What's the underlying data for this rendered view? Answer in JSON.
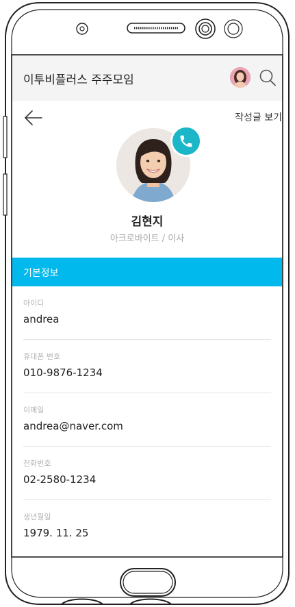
{
  "app": {
    "title": "이투비플러스 주주모임"
  },
  "header": {
    "posts_link": "작성글 보기"
  },
  "profile": {
    "name": "김현지",
    "subtitle": "아크로바이트 / 이사"
  },
  "section": {
    "title": "기본정보"
  },
  "fields": [
    {
      "label": "아이디",
      "value": "andrea"
    },
    {
      "label": "휴대폰 번호",
      "value": "010-9876-1234"
    },
    {
      "label": "이메일",
      "value": "andrea@naver.com"
    },
    {
      "label": "전화번호",
      "value": "02-2580-1234"
    },
    {
      "label": "생년월일",
      "value": "1979. 11. 25"
    }
  ],
  "colors": {
    "accent": "#02b9ee",
    "call_button": "#1bb7c9"
  },
  "icons": {
    "back": "arrow-left-icon",
    "search": "search-icon",
    "call": "phone-icon"
  }
}
